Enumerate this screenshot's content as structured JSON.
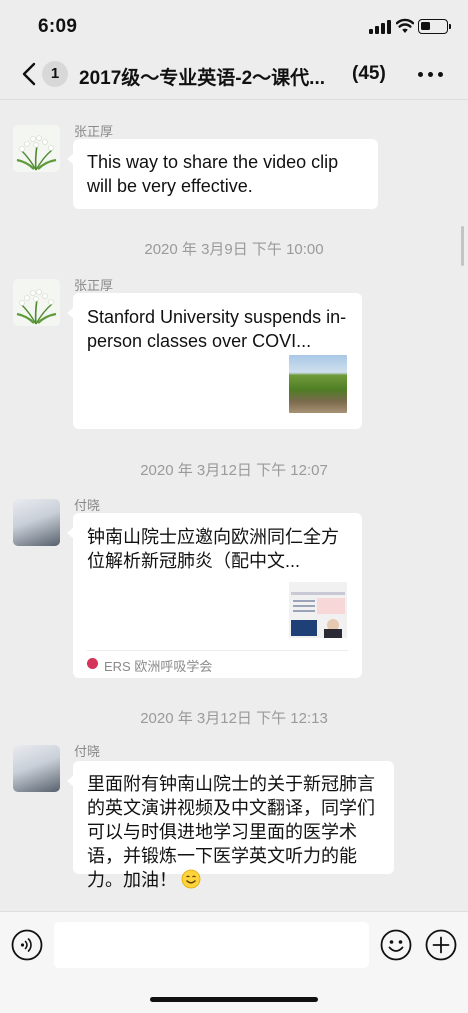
{
  "status_bar": {
    "time": "6:09"
  },
  "nav": {
    "unread_count": "1",
    "title": "2017级～专业英语-2～课代...",
    "member_count": "(45)"
  },
  "messages": [
    {
      "sender": "张正厚",
      "text": "This way to share the video clip will be very effective."
    },
    {
      "timestamp": "2020 年 3月9日 下午 10:00"
    },
    {
      "sender": "张正厚",
      "card_title": "Stanford University suspends in-person classes over COVI..."
    },
    {
      "timestamp": "2020 年 3月12日 下午 12:07"
    },
    {
      "sender": "付晓",
      "card_title": "钟南山院士应邀向欧洲同仁全方位解析新冠肺炎（配中文...",
      "source": "ERS 欧洲呼吸学会"
    },
    {
      "timestamp": "2020 年 3月12日 下午 12:13"
    },
    {
      "sender": "付晓",
      "text": "里面附有钟南山院士的关于新冠肺言的英文演讲视频及中文翻译，同学们可以与时俱进地学习里面的医学术语，并锻炼一下医学英文听力的能力。加油！"
    }
  ],
  "input": {
    "value": ""
  },
  "icons": {
    "back": "chevron-left-icon",
    "more": "more-dots-icon",
    "voice": "voice-icon",
    "emoji": "emoji-icon",
    "plus": "plus-icon",
    "smile": "smile-emoji"
  },
  "colors": {
    "background": "#ededed",
    "bubble": "#ffffff",
    "source_brand": "#d6335a"
  }
}
